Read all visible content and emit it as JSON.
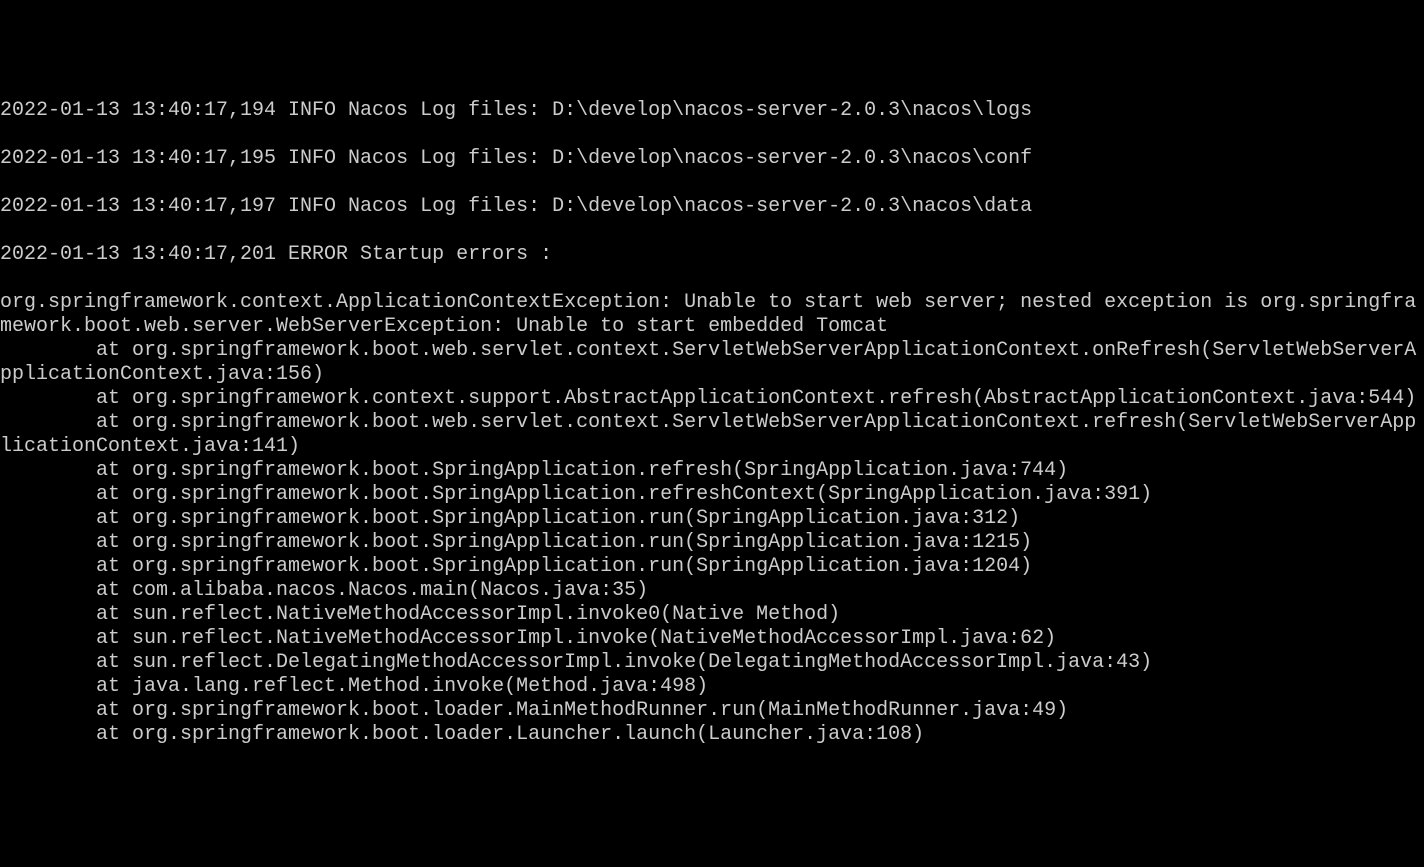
{
  "log": {
    "lines": [
      "2022-01-13 13:40:17,194 INFO Nacos Log files: D:\\develop\\nacos-server-2.0.3\\nacos\\logs",
      "",
      "2022-01-13 13:40:17,195 INFO Nacos Log files: D:\\develop\\nacos-server-2.0.3\\nacos\\conf",
      "",
      "2022-01-13 13:40:17,197 INFO Nacos Log files: D:\\develop\\nacos-server-2.0.3\\nacos\\data",
      "",
      "2022-01-13 13:40:17,201 ERROR Startup errors :",
      "",
      "org.springframework.context.ApplicationContextException: Unable to start web server; nested exception is org.springframework.boot.web.server.WebServerException: Unable to start embedded Tomcat",
      "        at org.springframework.boot.web.servlet.context.ServletWebServerApplicationContext.onRefresh(ServletWebServerApplicationContext.java:156)",
      "        at org.springframework.context.support.AbstractApplicationContext.refresh(AbstractApplicationContext.java:544)",
      "        at org.springframework.boot.web.servlet.context.ServletWebServerApplicationContext.refresh(ServletWebServerApplicationContext.java:141)",
      "        at org.springframework.boot.SpringApplication.refresh(SpringApplication.java:744)",
      "        at org.springframework.boot.SpringApplication.refreshContext(SpringApplication.java:391)",
      "        at org.springframework.boot.SpringApplication.run(SpringApplication.java:312)",
      "        at org.springframework.boot.SpringApplication.run(SpringApplication.java:1215)",
      "        at org.springframework.boot.SpringApplication.run(SpringApplication.java:1204)",
      "        at com.alibaba.nacos.Nacos.main(Nacos.java:35)",
      "        at sun.reflect.NativeMethodAccessorImpl.invoke0(Native Method)",
      "        at sun.reflect.NativeMethodAccessorImpl.invoke(NativeMethodAccessorImpl.java:62)",
      "        at sun.reflect.DelegatingMethodAccessorImpl.invoke(DelegatingMethodAccessorImpl.java:43)",
      "        at java.lang.reflect.Method.invoke(Method.java:498)",
      "        at org.springframework.boot.loader.MainMethodRunner.run(MainMethodRunner.java:49)",
      "        at org.springframework.boot.loader.Launcher.launch(Launcher.java:108)"
    ]
  }
}
